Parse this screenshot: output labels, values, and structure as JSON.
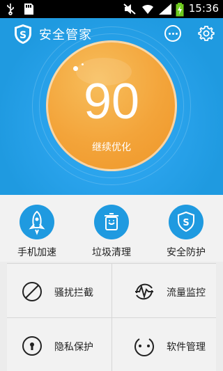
{
  "status_bar": {
    "time": "15:36"
  },
  "header": {
    "title": "安全管家"
  },
  "score": {
    "value": "90",
    "action_label": "继续优化"
  },
  "quick_actions": [
    {
      "label": "手机加速",
      "icon": "rocket-icon"
    },
    {
      "label": "垃圾清理",
      "icon": "trash-icon"
    },
    {
      "label": "安全防护",
      "icon": "shield-icon"
    }
  ],
  "tools": [
    {
      "label": "骚扰拦截",
      "icon": "block-icon"
    },
    {
      "label": "流量监控",
      "icon": "wave-icon"
    },
    {
      "label": "隐私保护",
      "icon": "lock-icon"
    },
    {
      "label": "软件管理",
      "icon": "apps-icon"
    }
  ],
  "colors": {
    "primary": "#1f9ae0",
    "score_ball": "#f3a43a",
    "background": "#ececec"
  }
}
